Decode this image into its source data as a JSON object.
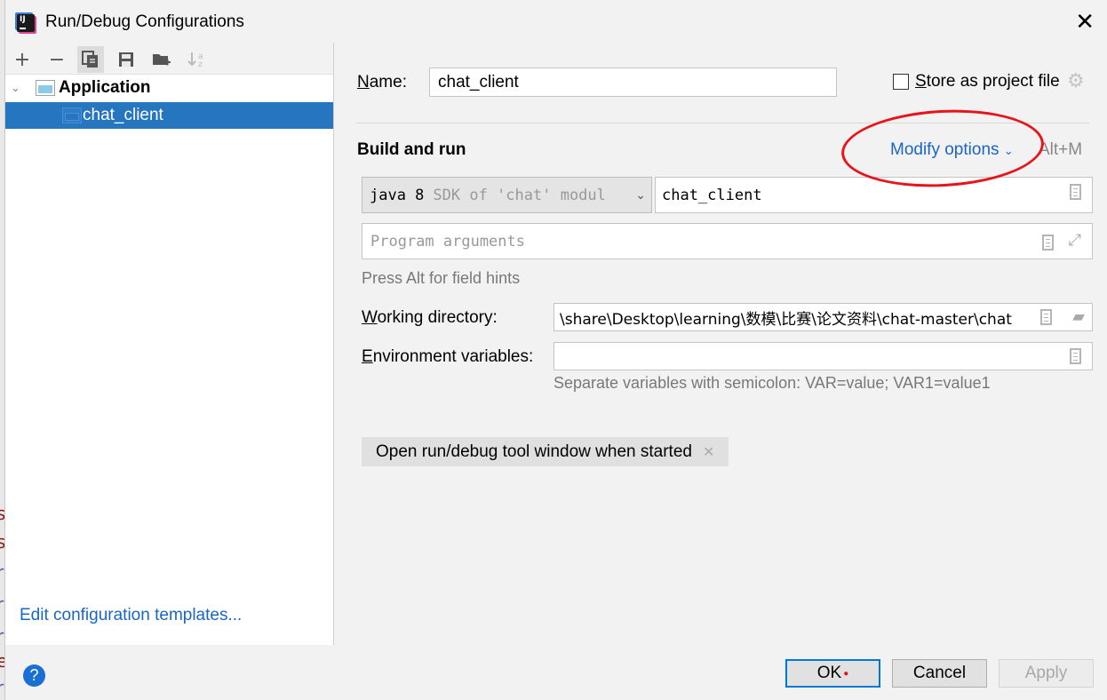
{
  "window": {
    "title": "Run/Debug Configurations"
  },
  "background_glyphs": [
    "s",
    "s",
    "r",
    "r",
    "r",
    "e",
    "r"
  ],
  "toolbar": {
    "buttons": [
      {
        "name": "add",
        "glyph": "+"
      },
      {
        "name": "remove",
        "glyph": "−"
      },
      {
        "name": "copy",
        "glyph": "⧉"
      },
      {
        "name": "save",
        "glyph": "💾"
      },
      {
        "name": "new-folder",
        "glyph": "▬"
      },
      {
        "name": "sort",
        "glyph": "↓ᵃz"
      }
    ]
  },
  "tree": {
    "group": {
      "label": "Application",
      "expanded": true
    },
    "items": [
      {
        "label": "chat_client",
        "selected": true
      }
    ]
  },
  "left_footer": {
    "edit_templates": "Edit configuration templates..."
  },
  "form": {
    "name_label": "Name:",
    "name_value": "chat_client",
    "store_label": "Store as project file",
    "store_checked": false,
    "section_title": "Build and run",
    "modify_options": "Modify options",
    "modify_shortcut": "Alt+M",
    "sdk_main": "java 8",
    "sdk_detail": "SDK of 'chat' modul",
    "main_class": "chat_client",
    "program_args_placeholder": "Program arguments",
    "field_hint": "Press Alt for field hints",
    "workdir_label": "Working directory:",
    "workdir_value": "\\share\\Desktop\\learning\\数模\\比赛\\论文资料\\chat-master\\chat",
    "env_label": "Environment variables:",
    "env_value": "",
    "env_hint": "Separate variables with semicolon: VAR=value; VAR1=value1",
    "option_chip": "Open run/debug tool window when started"
  },
  "buttons": {
    "ok": "OK",
    "cancel": "Cancel",
    "apply": "Apply"
  },
  "colors": {
    "accent": "#2675bf",
    "link": "#1a66c4",
    "annotation": "#e8141c"
  }
}
